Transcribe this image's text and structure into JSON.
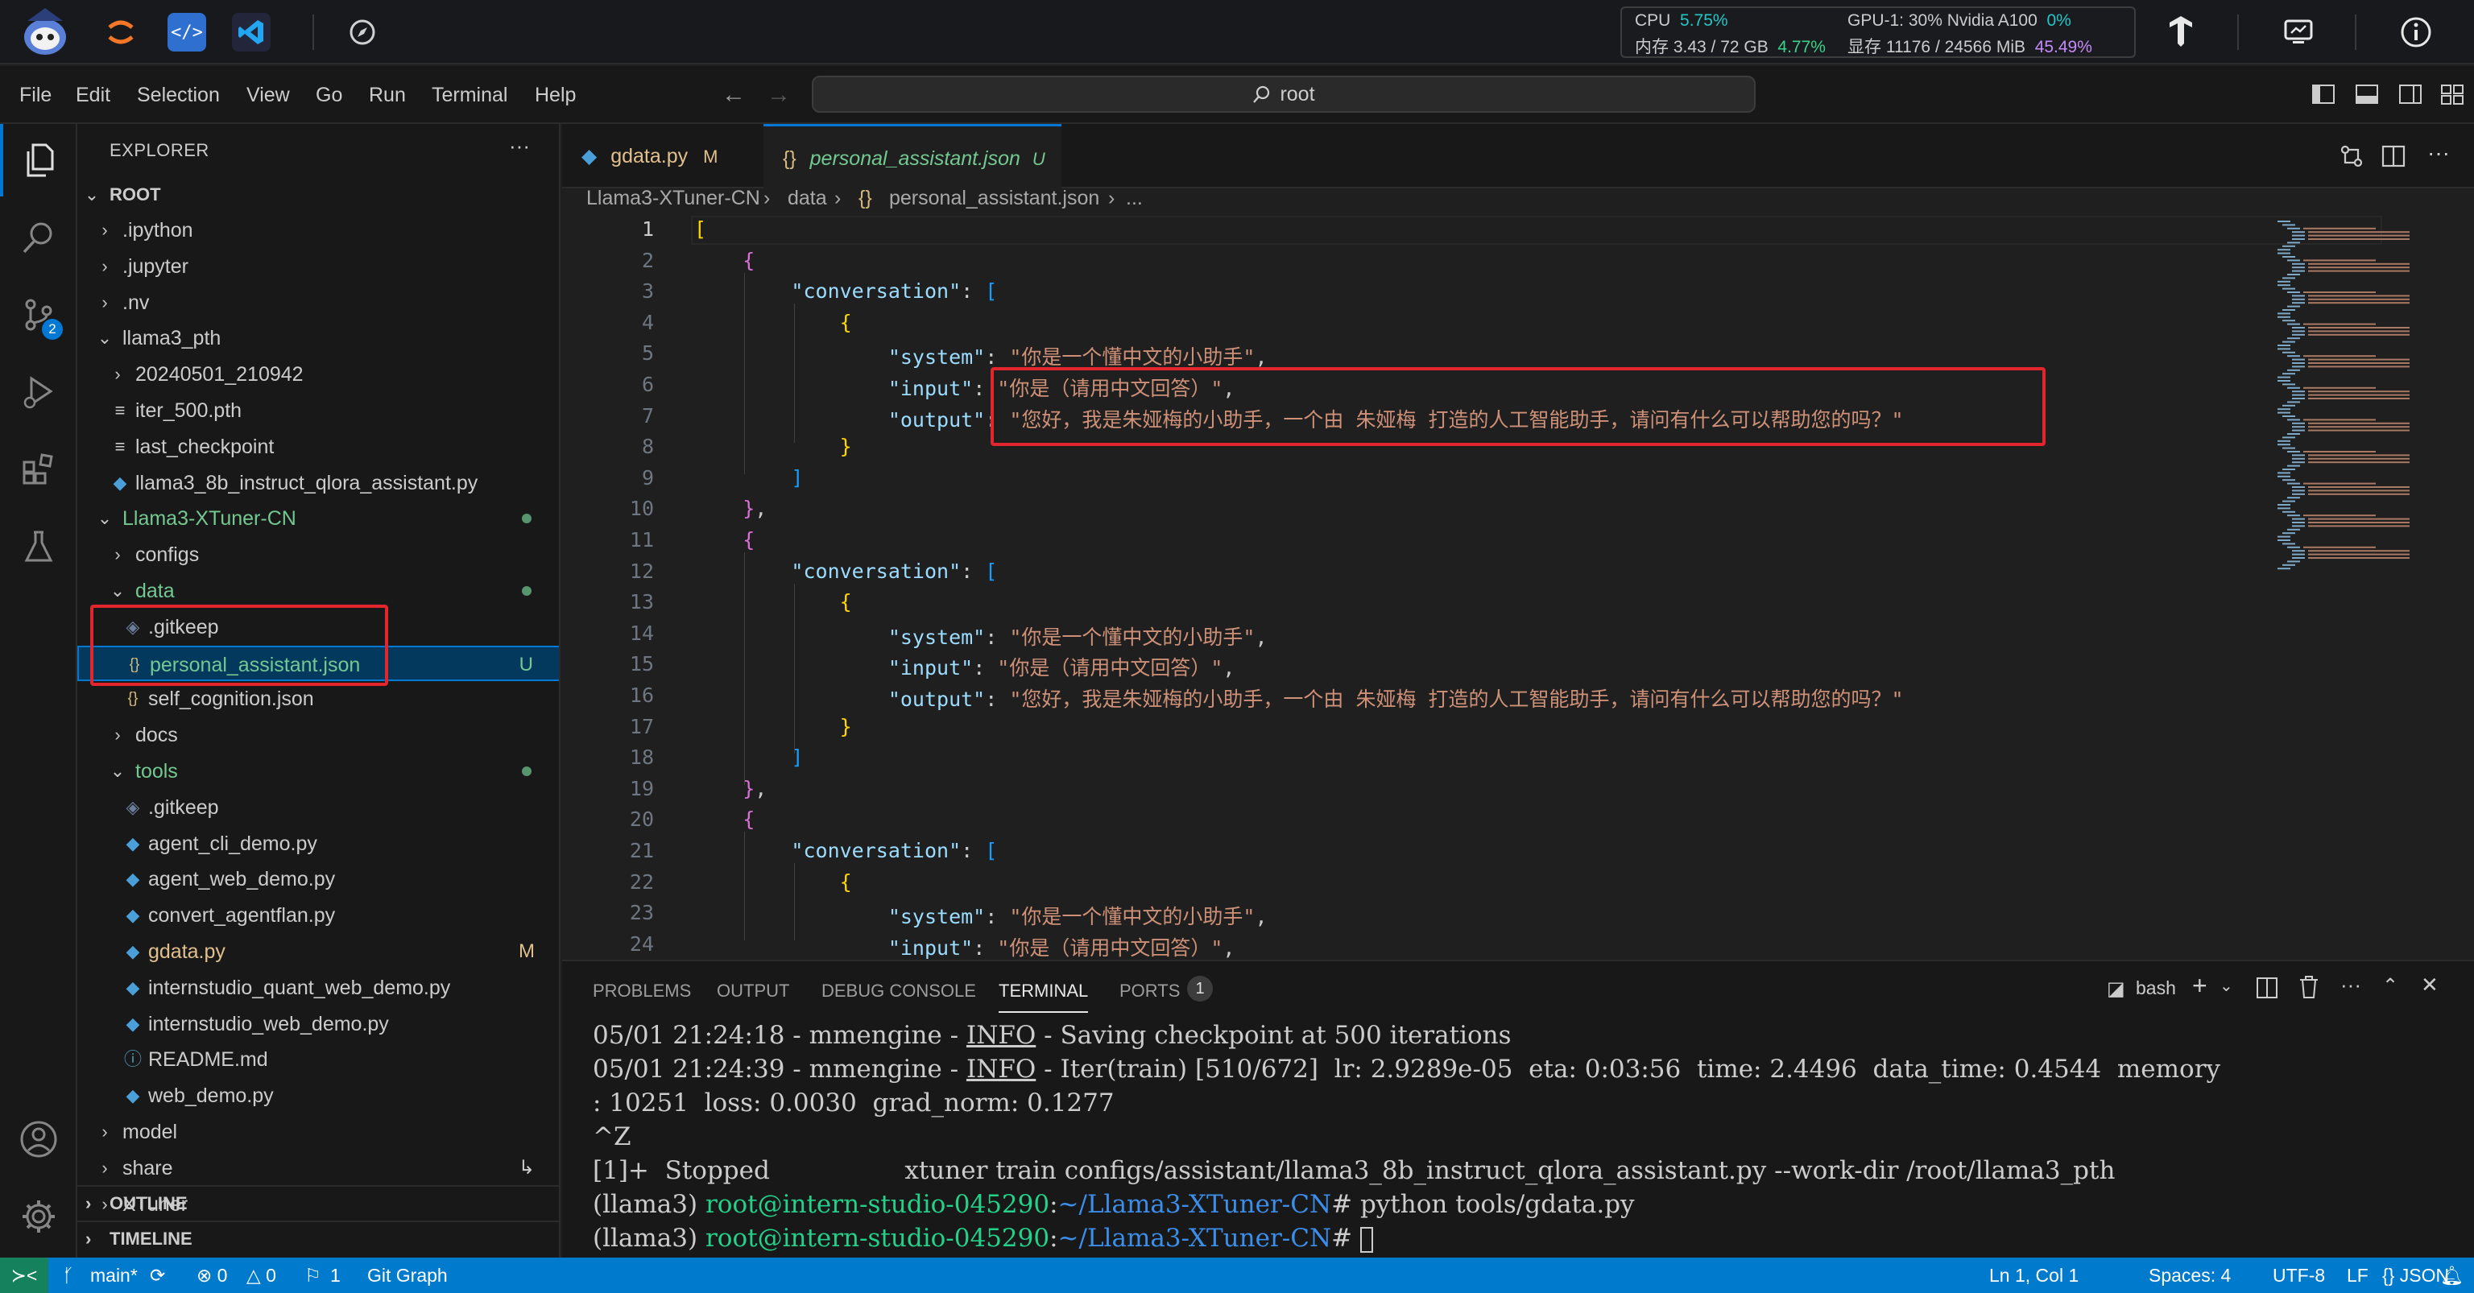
{
  "system_bar": {
    "cpu_label": "CPU",
    "cpu_pct": "5.75%",
    "gpu_label": "GPU-1: 30% Nvidia A100",
    "gpu_pct": "0%",
    "mem_label": "内存 3.43 / 72 GB",
    "mem_pct": "4.77%",
    "vram_label": "显存 11176 / 24566 MiB",
    "vram_pct": "45.49%"
  },
  "menu": [
    "File",
    "Edit",
    "Selection",
    "View",
    "Go",
    "Run",
    "Terminal",
    "Help"
  ],
  "search": {
    "text": "root"
  },
  "activity": {
    "scm_badge": "2"
  },
  "explorer": {
    "title": "EXPLORER",
    "more": "···",
    "root": "ROOT",
    "items": [
      {
        "label": ".ipython",
        "kind": "folder"
      },
      {
        "label": ".jupyter",
        "kind": "folder"
      },
      {
        "label": ".nv",
        "kind": "folder"
      },
      {
        "label": "llama3_pth",
        "kind": "folder-open"
      },
      {
        "label": "20240501_210942",
        "kind": "folder"
      },
      {
        "label": "iter_500.pth",
        "kind": "file"
      },
      {
        "label": "last_checkpoint",
        "kind": "file"
      },
      {
        "label": "llama3_8b_instruct_qlora_assistant.py",
        "kind": "py"
      },
      {
        "label": "Llama3-XTuner-CN",
        "kind": "folder-open"
      },
      {
        "label": "configs",
        "kind": "folder"
      },
      {
        "label": "data",
        "kind": "folder-open"
      },
      {
        "label": ".gitkeep",
        "kind": "git"
      },
      {
        "label": "personal_assistant.json",
        "kind": "json",
        "status": "U"
      },
      {
        "label": "self_cognition.json",
        "kind": "json"
      },
      {
        "label": "docs",
        "kind": "folder"
      },
      {
        "label": "tools",
        "kind": "folder-open"
      },
      {
        "label": ".gitkeep",
        "kind": "git"
      },
      {
        "label": "agent_cli_demo.py",
        "kind": "py"
      },
      {
        "label": "agent_web_demo.py",
        "kind": "py"
      },
      {
        "label": "convert_agentflan.py",
        "kind": "py"
      },
      {
        "label": "gdata.py",
        "kind": "py",
        "status": "M"
      },
      {
        "label": "internstudio_quant_web_demo.py",
        "kind": "py"
      },
      {
        "label": "internstudio_web_demo.py",
        "kind": "py"
      },
      {
        "label": "README.md",
        "kind": "info"
      },
      {
        "label": "web_demo.py",
        "kind": "py"
      },
      {
        "label": "model",
        "kind": "folder"
      },
      {
        "label": "share",
        "kind": "folder"
      },
      {
        "label": "XTuner",
        "kind": "folder"
      }
    ],
    "outline": "OUTLINE",
    "timeline": "TIMELINE"
  },
  "tabs": [
    {
      "label": "gdata.py",
      "status": "M"
    },
    {
      "label": "personal_assistant.json",
      "status": "U",
      "close": "✕"
    }
  ],
  "breadcrumb": [
    "Llama3-XTuner-CN",
    "data",
    "personal_assistant.json",
    "..."
  ],
  "editor": {
    "line_numbers": [
      "1",
      "2",
      "3",
      "4",
      "5",
      "6",
      "7",
      "8",
      "9",
      "10",
      "11",
      "12",
      "13",
      "14",
      "15",
      "16",
      "17",
      "18",
      "19",
      "20",
      "21",
      "22",
      "23",
      "24"
    ],
    "key_conversation": "\"conversation\"",
    "key_system": "\"system\"",
    "key_input": "\"input\"",
    "key_output": "\"output\"",
    "val_system": "\"你是一个懂中文的小助手\"",
    "val_input": "\"你是（请用中文回答）\"",
    "val_output": "\"您好，我是朱娅梅的小助手，一个由 朱娅梅 打造的人工智能助手，请问有什么可以帮助您的吗？\""
  },
  "panel": {
    "tabs": [
      "PROBLEMS",
      "OUTPUT",
      "DEBUG CONSOLE",
      "TERMINAL",
      "PORTS"
    ],
    "ports_count": "1",
    "shell": "bash",
    "lines": {
      "l1_a": "05/01 21:24:18 - mmengine - ",
      "l1_info": "INFO",
      "l1_b": " - Saving checkpoint at 500 iterations",
      "l2_a": "05/01 21:24:39 - mmengine - ",
      "l2_info": "INFO",
      "l2_b": " - Iter(train) [510/672]  lr: 2.9289e-05  eta: 0:03:56  time: 2.4496  data_time: 0.4544  memory",
      "l3": ": 10251  loss: 0.0030  grad_norm: 0.1277",
      "l4": "^Z",
      "l5": "[1]+  Stopped                 xtuner train configs/assistant/llama3_8b_instruct_qlora_assistant.py --work-dir /root/llama3_pth",
      "p_env": "(llama3) ",
      "p_user": "root@intern-studio-045290",
      "p_colon": ":",
      "p_path": "~/Llama3-XTuner-CN",
      "p_hash": "# ",
      "cmd1": "python tools/gdata.py",
      "cmd2": ""
    }
  },
  "status": {
    "branch": "main*",
    "errors": "⊗ 0",
    "warnings": "△ 0",
    "ports": "1",
    "gitgraph": "Git Graph",
    "position": "Ln 1, Col 1",
    "spaces": "Spaces: 4",
    "encoding": "UTF-8",
    "eol": "LF",
    "language": "{} JSON"
  }
}
